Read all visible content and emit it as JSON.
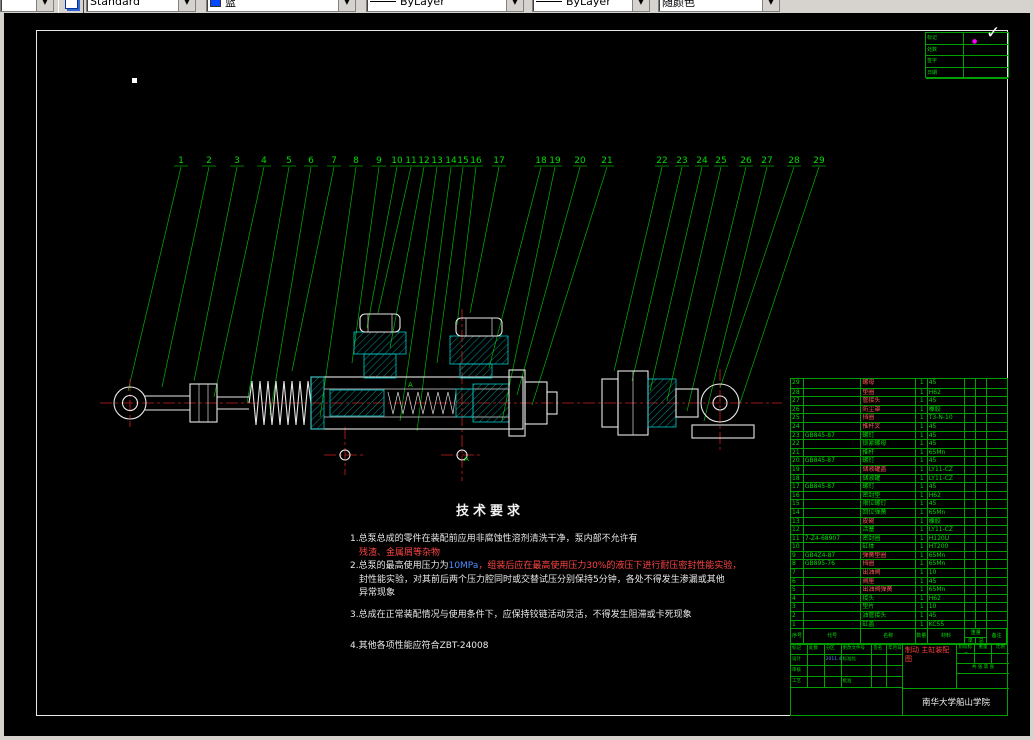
{
  "toolbar": {
    "layer_value": "",
    "style_value": "Standard",
    "color_value": "蓝",
    "linetype_value": "ByLayer",
    "lineweight_value": "ByLayer",
    "plotstyle_value": "随颜色"
  },
  "colors": {
    "leader_green": "#00b400",
    "centerline_red": "#cc2020",
    "hatch_cyan": "#00c8c8",
    "table_green": "#00a000",
    "title_red": "#ff4040",
    "swatch_blue": "#0048ff"
  },
  "part_numbers": {
    "group1": [
      "1",
      "2",
      "3",
      "4",
      "5",
      "6",
      "7",
      "8",
      "9",
      "10",
      "11",
      "12",
      "13",
      "14",
      "15",
      "16",
      "17",
      "18",
      "19",
      "20",
      "21"
    ],
    "group2": [
      "22",
      "23",
      "24",
      "25",
      "26",
      "27",
      "28",
      "29"
    ]
  },
  "drawing": {
    "detail_marks": [
      "A",
      "A"
    ]
  },
  "tech_requirements": {
    "title": "技术要求",
    "lines": [
      {
        "segments": [
          {
            "t": "1.总泵总成的零件在装配前应用非腐蚀性溶剂清洗干净，泵内部不允许有",
            "c": "white"
          }
        ]
      },
      {
        "indent": true,
        "segments": [
          {
            "t": "残渣、金属屑等杂物",
            "c": "red"
          }
        ]
      },
      {
        "segments": [
          {
            "t": "2.总泵的最高使用压力为",
            "c": "white"
          },
          {
            "t": "10MPa",
            "c": "blue"
          },
          {
            "t": "，组装后应在最高使用压力30%的液压下进行耐压密封性能实验，",
            "c": "red"
          }
        ]
      },
      {
        "indent": true,
        "segments": [
          {
            "t": "封性能实验，对其前后两个压力腔同时或交替试压分别保持5分钟，各处不得发生渗漏或其他",
            "c": "white"
          }
        ]
      },
      {
        "indent": true,
        "segments": [
          {
            "t": "异常现象",
            "c": "white"
          }
        ]
      },
      {
        "gap": 8,
        "segments": [
          {
            "t": "3.总成在正常装配情况与使用条件下，应保持铰链活动灵活，不得发生阻滞或卡死现象",
            "c": "white"
          }
        ]
      },
      {
        "gap": 18,
        "segments": [
          {
            "t": "4.其他各项性能应符合ZBT-24008",
            "c": "white"
          }
        ]
      }
    ]
  },
  "bom": {
    "headers": {
      "no": "序号",
      "code": "代号",
      "name": "名称",
      "qty": "数量",
      "material": "材料",
      "weight": "重量",
      "unit": "单件",
      "total": "总计",
      "note": "备注"
    },
    "rows": [
      {
        "no": "29",
        "code": "",
        "name": "螺母",
        "qty": "1",
        "material": "45",
        "nameColor": "red"
      },
      {
        "no": "28",
        "code": "",
        "name": "垫圈",
        "qty": "1",
        "material": "H62",
        "nameColor": "red"
      },
      {
        "no": "27",
        "code": "",
        "name": "管接头",
        "qty": "1",
        "material": "45",
        "nameColor": "red"
      },
      {
        "no": "26",
        "code": "",
        "name": "防尘罩",
        "qty": "1",
        "material": "橡胶",
        "nameColor": "red"
      },
      {
        "no": "25",
        "code": "",
        "name": "挡圈",
        "qty": "1",
        "material": "T3-N-10",
        "nameColor": "red"
      },
      {
        "no": "24",
        "code": "",
        "name": "推杆叉",
        "qty": "1",
        "material": "45",
        "nameColor": "red"
      },
      {
        "no": "23",
        "code": "GB845-87",
        "name": "螺钉",
        "qty": "1",
        "material": "45"
      },
      {
        "no": "22",
        "code": "",
        "name": "锁紧螺母",
        "qty": "1",
        "material": "45"
      },
      {
        "no": "21",
        "code": "",
        "name": "推杆",
        "qty": "1",
        "material": "65Mn"
      },
      {
        "no": "20",
        "code": "GB845-87",
        "name": "螺钉",
        "qty": "1",
        "material": "45"
      },
      {
        "no": "19",
        "code": "",
        "name": "储液罐盖",
        "qty": "1",
        "material": "LY11-CZ",
        "nameColor": "red"
      },
      {
        "no": "18",
        "code": "",
        "name": "储液罐",
        "qty": "1",
        "material": "LY11-CZ"
      },
      {
        "no": "17",
        "code": "GB845-87",
        "name": "螺钉",
        "qty": "1",
        "material": "45"
      },
      {
        "no": "16",
        "code": "",
        "name": "密封垫",
        "qty": "1",
        "material": "H62"
      },
      {
        "no": "15",
        "code": "",
        "name": "限位螺钉",
        "qty": "1",
        "material": "45"
      },
      {
        "no": "14",
        "code": "",
        "name": "回位弹簧",
        "qty": "1",
        "material": "65Mn"
      },
      {
        "no": "13",
        "code": "",
        "name": "皮碗",
        "qty": "1",
        "material": "橡胶",
        "nameColor": "red"
      },
      {
        "no": "12",
        "code": "",
        "name": "活塞",
        "qty": "1",
        "material": "LY11-CZ"
      },
      {
        "no": "11",
        "code": "7-Z4-68907",
        "name": "密封圈",
        "qty": "1",
        "material": "H120U"
      },
      {
        "no": "10",
        "code": "",
        "name": "缸体",
        "qty": "1",
        "material": "HT200"
      },
      {
        "no": "9",
        "code": "GB4Z4-87",
        "name": "弹簧垫圈",
        "qty": "1",
        "material": "65Mn",
        "nameColor": "red"
      },
      {
        "no": "8",
        "code": "GB895-76",
        "name": "挡圈",
        "qty": "1",
        "material": "65Mn",
        "nameColor": "red"
      },
      {
        "no": "7",
        "code": "",
        "name": "出油阀",
        "qty": "1",
        "material": "10",
        "nameColor": "red"
      },
      {
        "no": "6",
        "code": "",
        "name": "阀座",
        "qty": "1",
        "material": "45",
        "nameColor": "red"
      },
      {
        "no": "5",
        "code": "",
        "name": "出油阀弹簧",
        "qty": "1",
        "material": "65Mn",
        "nameColor": "red"
      },
      {
        "no": "4",
        "code": "",
        "name": "接头",
        "qty": "1",
        "material": "H62"
      },
      {
        "no": "3",
        "code": "",
        "name": "垫片",
        "qty": "1",
        "material": "10"
      },
      {
        "no": "2",
        "code": "",
        "name": "油管接头",
        "qty": "1",
        "material": "45"
      },
      {
        "no": "1",
        "code": "",
        "name": "缸盖",
        "qty": "1",
        "material": "KC55"
      }
    ]
  },
  "title_block": {
    "mark": "标记",
    "count": "处数",
    "zone": "分区",
    "change_file": "更改文件号",
    "sign": "签名",
    "date_head": "年月日",
    "design": "设计",
    "standardize": "标准化",
    "review": "审核",
    "craft": "工艺",
    "approve": "批准",
    "date_value": "2011.4.8",
    "stage_mark": "阶段标记",
    "weight": "重量",
    "scale": "比例",
    "sheet": "共 张 第 张",
    "title_line1": "制动 主缸装配",
    "title_line2": "图",
    "school": "南华大学船山学院"
  },
  "rev_table": {
    "rows": [
      {
        "label": "标记"
      },
      {
        "label": "处数"
      },
      {
        "label": "签字"
      },
      {
        "label": "日期"
      }
    ],
    "dot": "●",
    "check": "✓"
  }
}
